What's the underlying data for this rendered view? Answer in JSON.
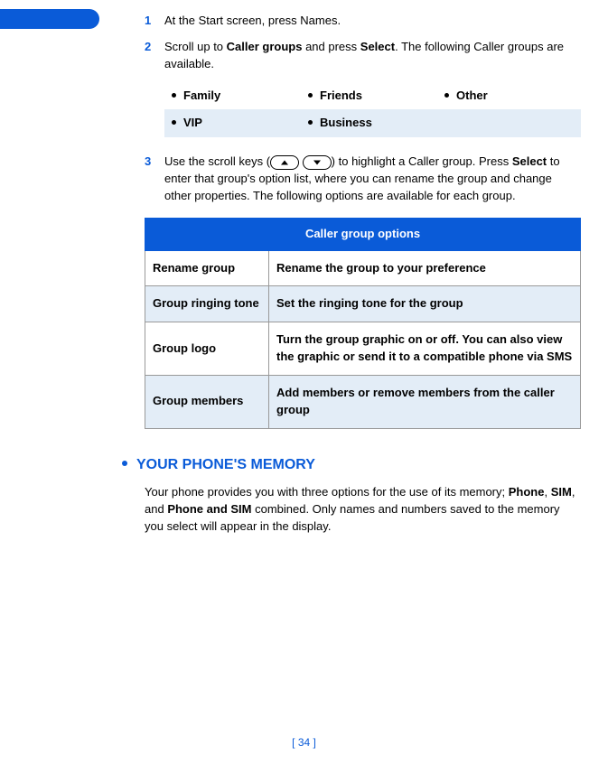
{
  "steps": {
    "s1": {
      "num": "1",
      "text_a": "At the Start screen, press Names."
    },
    "s2": {
      "num": "2",
      "text_a": "Scroll up to ",
      "bold_a": "Caller groups",
      "text_b": " and press ",
      "bold_b": "Select",
      "text_c": ". The following Caller groups are available."
    },
    "s3": {
      "num": "3",
      "text_a": "Use the scroll keys (",
      "text_b": ") to highlight a Caller group. Press ",
      "bold_a": "Select",
      "text_c": " to enter that group's option list, where you can rename the group and change other properties. The following options are available for each group."
    }
  },
  "groups": {
    "r1c1": "Family",
    "r1c2": "Friends",
    "r1c3": "Other",
    "r2c1": "VIP",
    "r2c2": "Business"
  },
  "options_table": {
    "header": "Caller group options",
    "rows": {
      "r1": {
        "label": "Rename group",
        "desc": "Rename the group to your preference"
      },
      "r2": {
        "label": "Group ringing tone",
        "desc": "Set the ringing tone for the group"
      },
      "r3": {
        "label": "Group logo",
        "desc": "Turn the group graphic on or off. You can also view the graphic or send it to a compatible phone via SMS"
      },
      "r4": {
        "label": "Group members",
        "desc": "Add members or remove members from the caller group"
      }
    }
  },
  "section": {
    "title": "YOUR PHONE'S MEMORY",
    "p_a": "Your phone provides you with three options for the use of its memory; ",
    "p_b1": "Phone",
    "p_sep1": ", ",
    "p_b2": "SIM",
    "p_sep2": ", and ",
    "p_b3": "Phone and SIM",
    "p_c": " combined. Only names and numbers saved to the memory you select will appear in the display."
  },
  "footer": {
    "text": "[ 34 ]"
  }
}
